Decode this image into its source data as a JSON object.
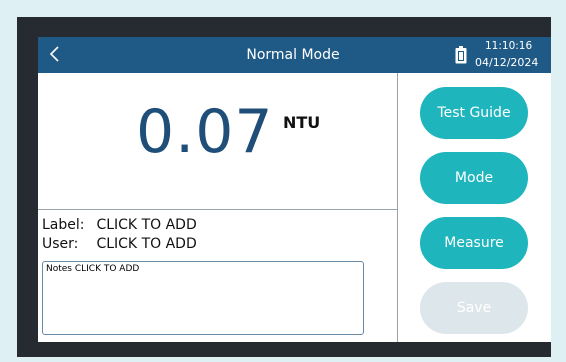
{
  "header": {
    "back_icon": "chevron-left-icon",
    "title": "Normal Mode",
    "battery_icon": "battery-icon",
    "time": "11:10:16",
    "date": "04/12/2024"
  },
  "reading": {
    "value": "0.07",
    "unit": "NTU"
  },
  "info": {
    "label_key": "Label:",
    "label_value": "CLICK TO ADD",
    "user_key": "User:",
    "user_value": "CLICK TO ADD",
    "notes": "Notes CLICK TO ADD"
  },
  "buttons": {
    "test_guide": "Test Guide",
    "mode": "Mode",
    "measure": "Measure",
    "save": "Save"
  },
  "colors": {
    "header_bg": "#1f5a86",
    "button_bg": "#1fb5bd",
    "button_disabled_bg": "#dde6ea",
    "reading_color": "#1f4e79"
  }
}
